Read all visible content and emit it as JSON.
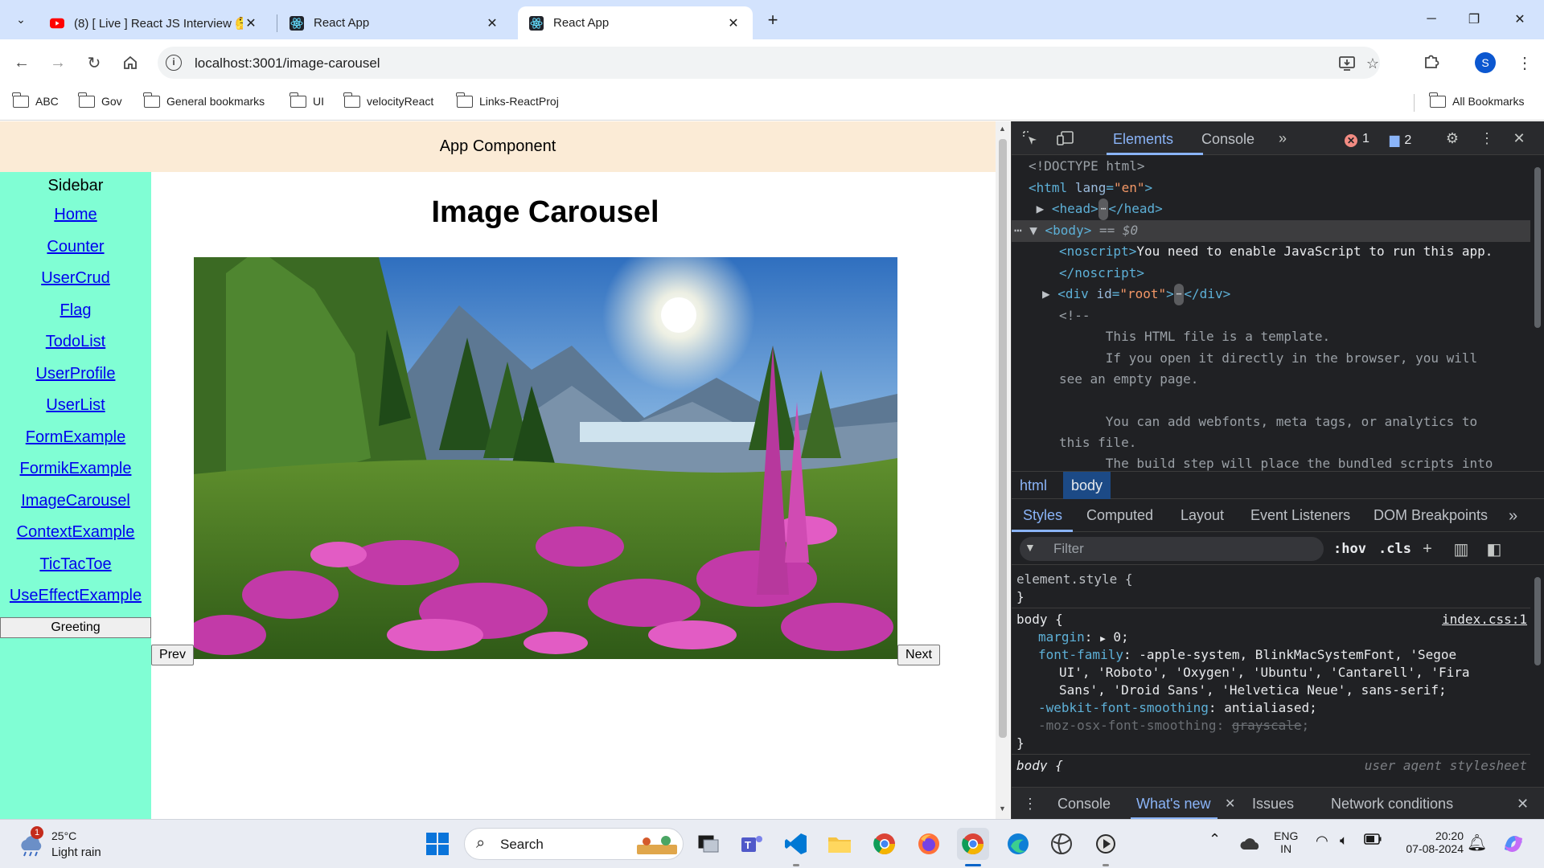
{
  "browser": {
    "tabs": [
      {
        "title": "(8) [ Live ] React JS Interview 🤔",
        "icon": "youtube-icon",
        "active": false
      },
      {
        "title": "React App",
        "icon": "react-icon",
        "active": false
      },
      {
        "title": "React App",
        "icon": "react-icon",
        "active": true
      }
    ],
    "url": "localhost:3001/image-carousel",
    "profile_initial": "S",
    "bookmarks": [
      "ABC",
      "Gov",
      "General bookmarks",
      "UI",
      "velocityReact",
      "Links-ReactProj"
    ],
    "all_bookmarks": "All Bookmarks"
  },
  "app": {
    "header": "App Component",
    "sidebar": {
      "title": "Sidebar",
      "links": [
        "Home",
        "Counter",
        "UserCrud",
        "Flag",
        "TodoList",
        "UserProfile",
        "UserList",
        "FormExample",
        "FormikExample",
        "ImageCarousel",
        "ContextExample",
        "TicTacToe",
        "UseEffectExample"
      ],
      "greeting_button": "Greeting"
    },
    "page_title": "Image Carousel",
    "prev_label": "Prev",
    "next_label": "Next",
    "image_alt": "mountain landscape with pink fireweed flowers"
  },
  "devtools": {
    "tabs": [
      "Elements",
      "Console"
    ],
    "errors": "1",
    "messages": "2",
    "dom": {
      "doctype": "<!DOCTYPE html>",
      "html_open": "<html",
      "lang_attr": "lang",
      "lang_val": "\"en\"",
      "head": "<head>",
      "head_close": "</head>",
      "body": "<body>",
      "body_ref": "== $0",
      "noscript_open": "<noscript>",
      "noscript_text": "You need to enable JavaScript to run this app.",
      "noscript_close": "</noscript>",
      "div_open": "<div",
      "id_attr": "id",
      "id_val": "\"root\"",
      "div_close": "</div>",
      "comment_open": "<!--",
      "comment_lines": [
        "      This HTML file is a template.",
        "      If you open it directly in the browser, you will",
        "see an empty page.",
        "",
        "      You can add webfonts, meta tags, or analytics to",
        "this file.",
        "      The build step will place the bundled scripts into"
      ]
    },
    "breadcrumbs": [
      "html",
      "body"
    ],
    "subtabs": [
      "Styles",
      "Computed",
      "Layout",
      "Event Listeners",
      "DOM Breakpoints"
    ],
    "filter_placeholder": "Filter",
    "hov": ":hov",
    "cls": ".cls",
    "styles": {
      "element_style": "element.style {",
      "close": "}",
      "body_selector": "body {",
      "source": "index.css:1",
      "margin_prop": "margin",
      "margin_val": "0;",
      "ff_prop": "font-family",
      "ff_val_1": "-apple-system, BlinkMacSystemFont, 'Segoe",
      "ff_val_2": "UI', 'Roboto', 'Oxygen', 'Ubuntu', 'Cantarell', 'Fira",
      "ff_val_3": "Sans', 'Droid Sans', 'Helvetica Neue', sans-serif;",
      "wfs_prop": "-webkit-font-smoothing",
      "wfs_val": "antialiased;",
      "moz_prop": "-moz-osx-font-smoothing",
      "moz_val": "grayscale",
      "next_selector": "body {",
      "ua_label": "user agent stylesheet"
    },
    "drawer": [
      "Console",
      "What's new",
      "Issues",
      "Network conditions"
    ]
  },
  "taskbar": {
    "temp": "25°C",
    "weather": "Light rain",
    "weather_badge": "1",
    "search_placeholder": "Search",
    "lang_1": "ENG",
    "lang_2": "IN",
    "time": "20:20",
    "date": "07-08-2024"
  }
}
